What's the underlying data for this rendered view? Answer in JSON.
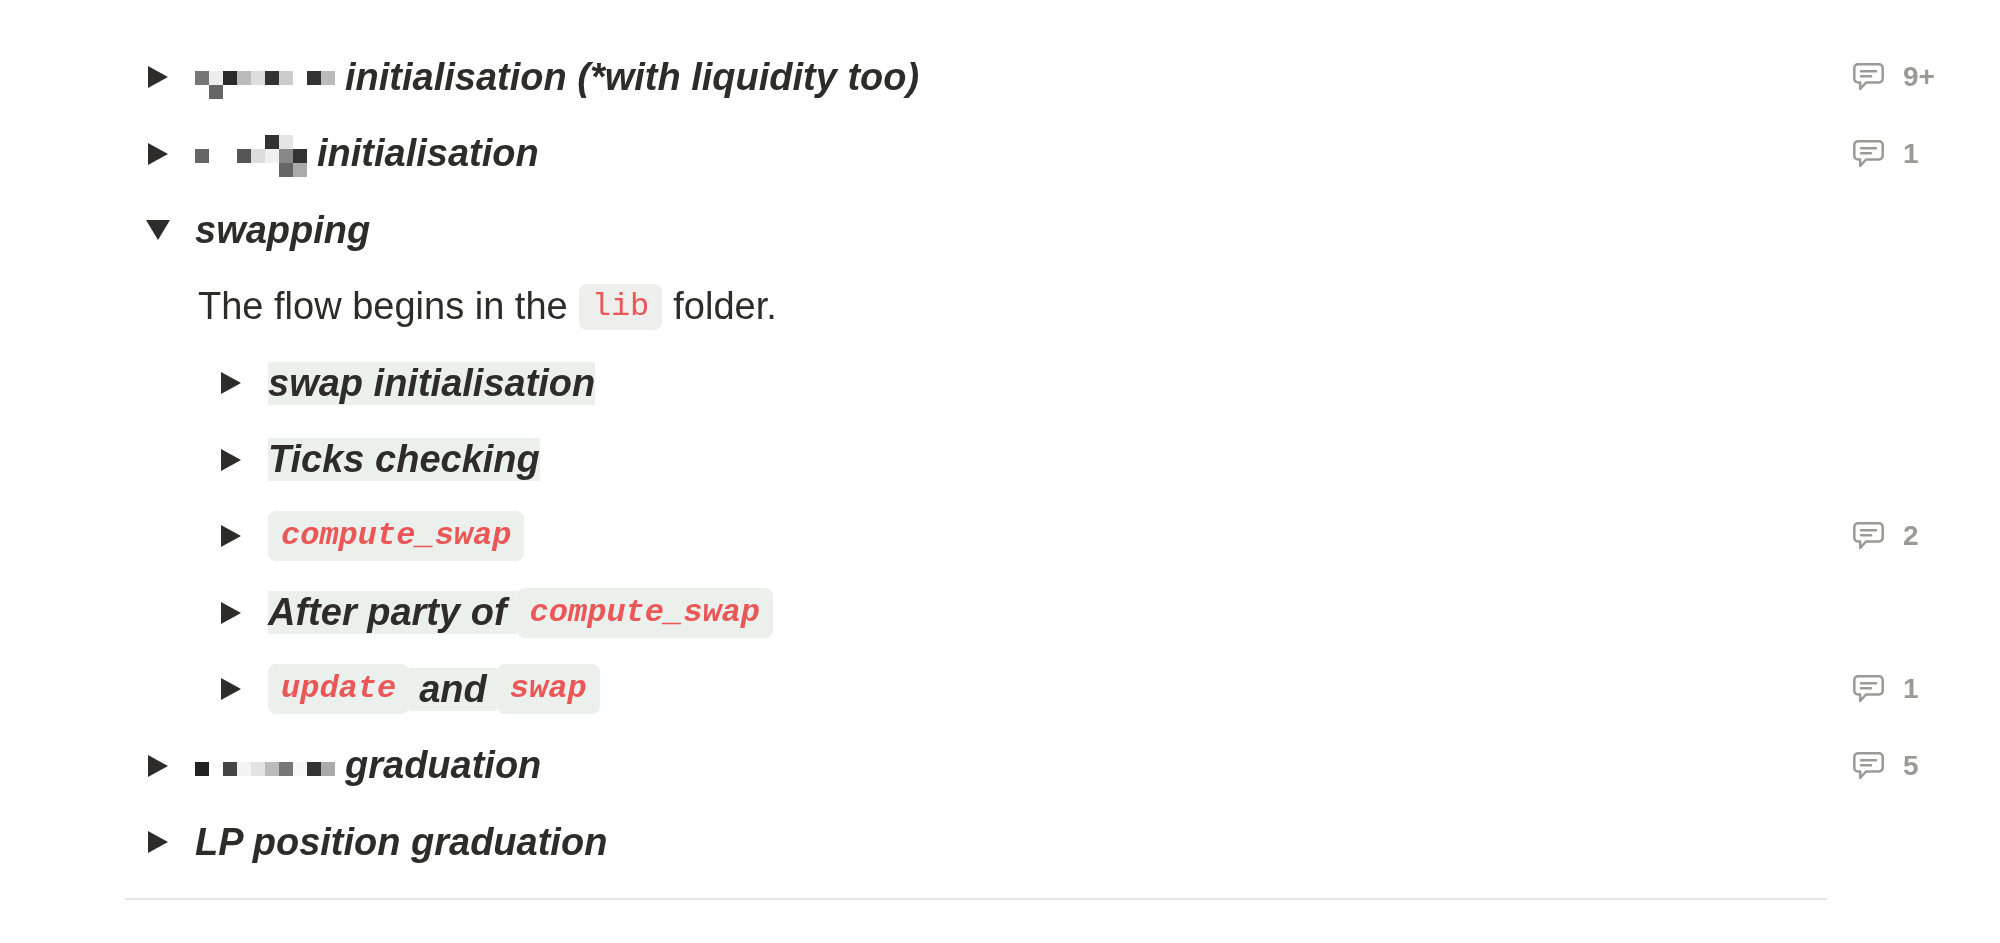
{
  "outline": {
    "items": [
      {
        "kind": "toggle",
        "expanded": false,
        "highlighted": false,
        "title": [
          {
            "kind": "redacted"
          },
          {
            "kind": "text",
            "text": "initialisation (*with liquidity too)"
          }
        ],
        "comments": "9+"
      },
      {
        "kind": "toggle",
        "expanded": false,
        "highlighted": false,
        "title": [
          {
            "kind": "redacted"
          },
          {
            "kind": "text",
            "text": "initialisation"
          }
        ],
        "comments": "1"
      },
      {
        "kind": "toggle",
        "expanded": true,
        "highlighted": false,
        "title": [
          {
            "kind": "text",
            "text": "swapping"
          }
        ],
        "children": [
          {
            "kind": "paragraph",
            "content": [
              {
                "kind": "text",
                "text": "The flow begins in the"
              },
              {
                "kind": "code",
                "text": "lib"
              },
              {
                "kind": "text",
                "text": "folder."
              }
            ]
          },
          {
            "kind": "toggle",
            "expanded": false,
            "highlighted": true,
            "title": [
              {
                "kind": "text",
                "text": "swap initialisation"
              }
            ]
          },
          {
            "kind": "toggle",
            "expanded": false,
            "highlighted": true,
            "title": [
              {
                "kind": "text",
                "text": "Ticks checking"
              }
            ]
          },
          {
            "kind": "toggle",
            "expanded": false,
            "highlighted": true,
            "title": [
              {
                "kind": "code",
                "text": "compute_swap"
              }
            ],
            "comments": "2"
          },
          {
            "kind": "toggle",
            "expanded": false,
            "highlighted": true,
            "title": [
              {
                "kind": "text",
                "text": "After party of"
              },
              {
                "kind": "code",
                "text": "compute_swap"
              }
            ]
          },
          {
            "kind": "toggle",
            "expanded": false,
            "highlighted": true,
            "title": [
              {
                "kind": "code",
                "text": "update"
              },
              {
                "kind": "text",
                "text": "and"
              },
              {
                "kind": "code",
                "text": "swap"
              }
            ],
            "comments": "1"
          }
        ]
      },
      {
        "kind": "toggle",
        "expanded": false,
        "highlighted": false,
        "title": [
          {
            "kind": "redacted"
          },
          {
            "kind": "text",
            "text": "graduation"
          }
        ],
        "comments": "5"
      },
      {
        "kind": "toggle",
        "expanded": false,
        "highlighted": false,
        "title": [
          {
            "kind": "text",
            "text": "LP position graduation"
          }
        ]
      }
    ]
  }
}
